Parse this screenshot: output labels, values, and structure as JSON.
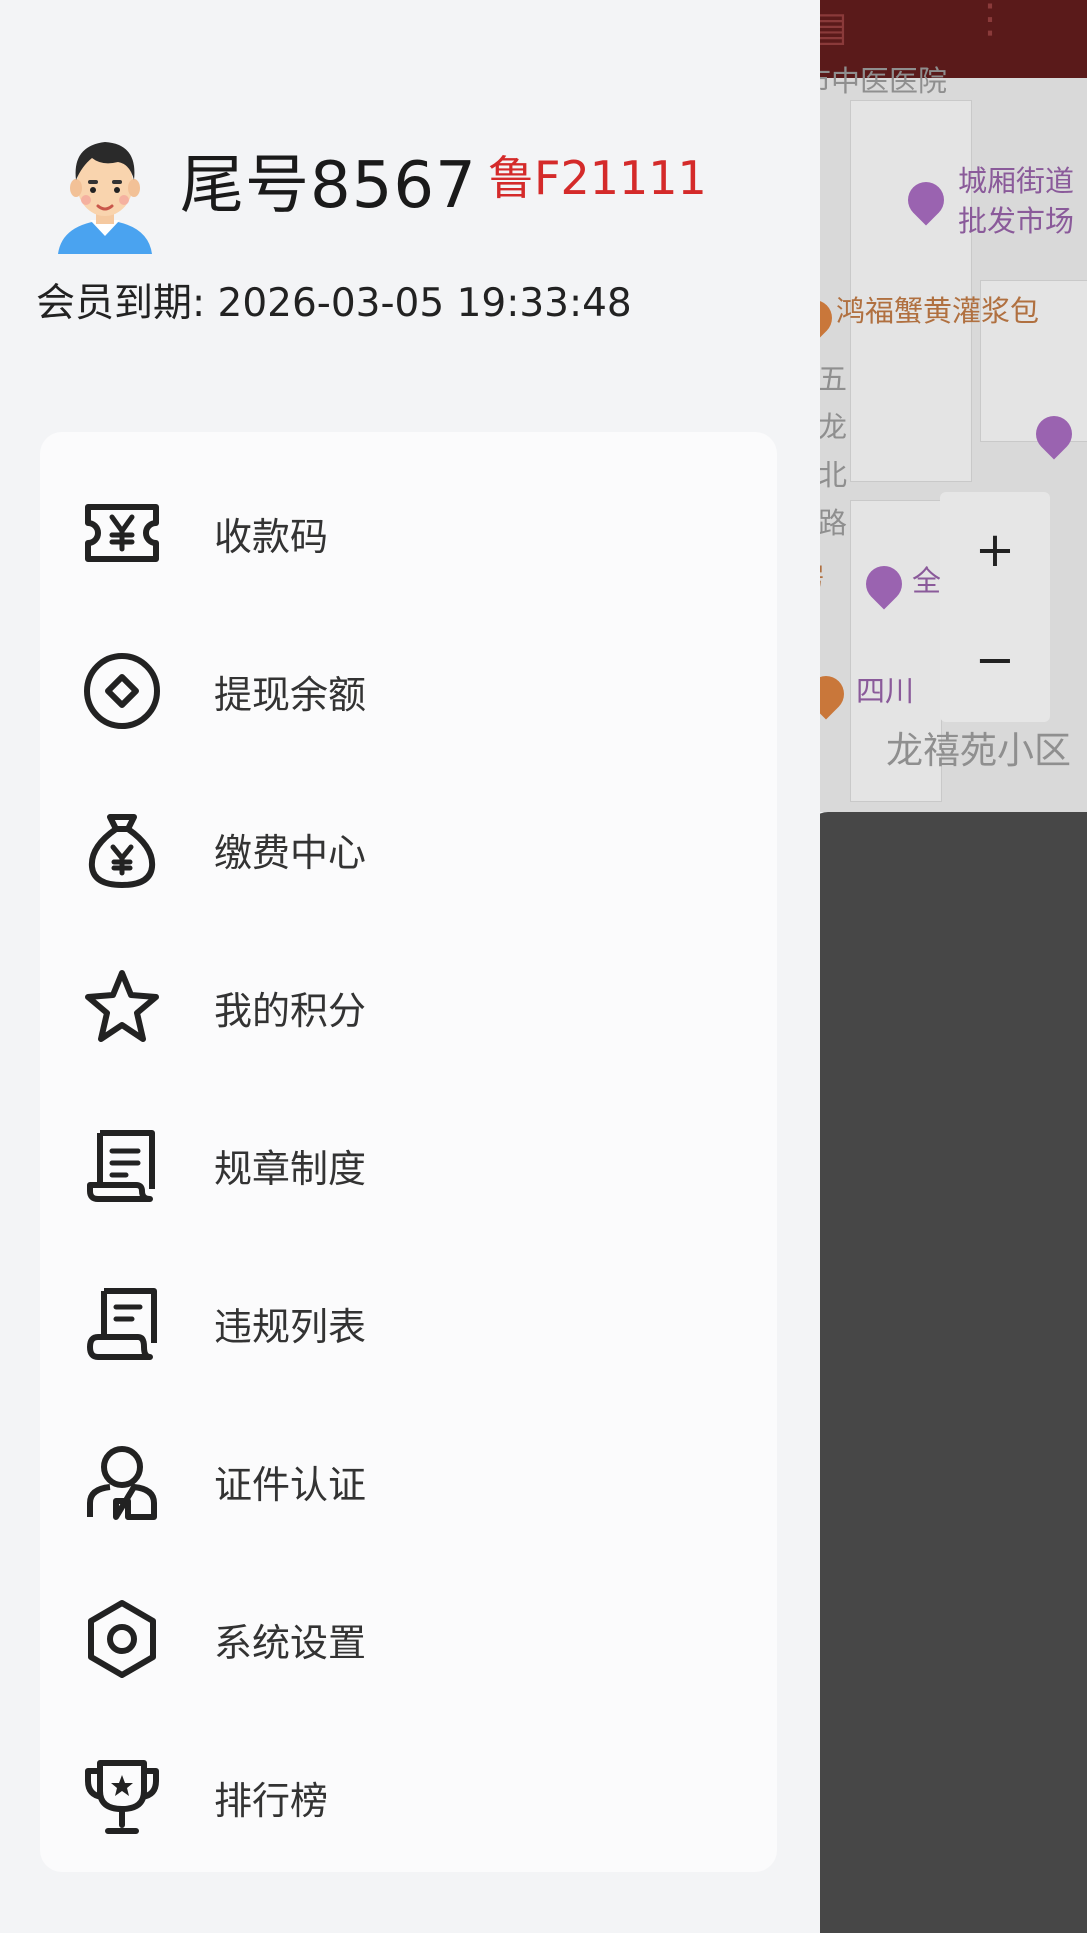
{
  "user": {
    "name": "尾号8567",
    "plate": "鲁F21111",
    "expiry": "会员到期: 2026-03-05 19:33:48"
  },
  "menu": [
    {
      "label": "收款码",
      "icon": "ticket-yuan-icon"
    },
    {
      "label": "提现余额",
      "icon": "coin-icon"
    },
    {
      "label": "缴费中心",
      "icon": "money-bag-icon"
    },
    {
      "label": "我的积分",
      "icon": "star-icon"
    },
    {
      "label": "规章制度",
      "icon": "scroll-document-icon"
    },
    {
      "label": "违规列表",
      "icon": "scroll-list-icon"
    },
    {
      "label": "证件认证",
      "icon": "person-icon"
    },
    {
      "label": "系统设置",
      "icon": "hexagon-settings-icon"
    },
    {
      "label": "排行榜",
      "icon": "trophy-icon"
    }
  ],
  "map": {
    "labels": {
      "hospital": "市中医医院",
      "street": "城厢街道",
      "market": "批发市场",
      "restaurant": "鸿福蟹黄灌浆包",
      "road_1": "五",
      "road_2": "龙",
      "road_3": "北",
      "road_4": "路",
      "house": "房",
      "hotel": "全",
      "sichuan": "四川",
      "community": "龙禧苑小区"
    },
    "zoom_in": "+",
    "zoom_out": "−"
  },
  "colors": {
    "accent_red": "#d42a2a",
    "topbar": "#5a1a1a",
    "poi_purple": "#8a4d9e",
    "poi_orange": "#c9773a"
  }
}
